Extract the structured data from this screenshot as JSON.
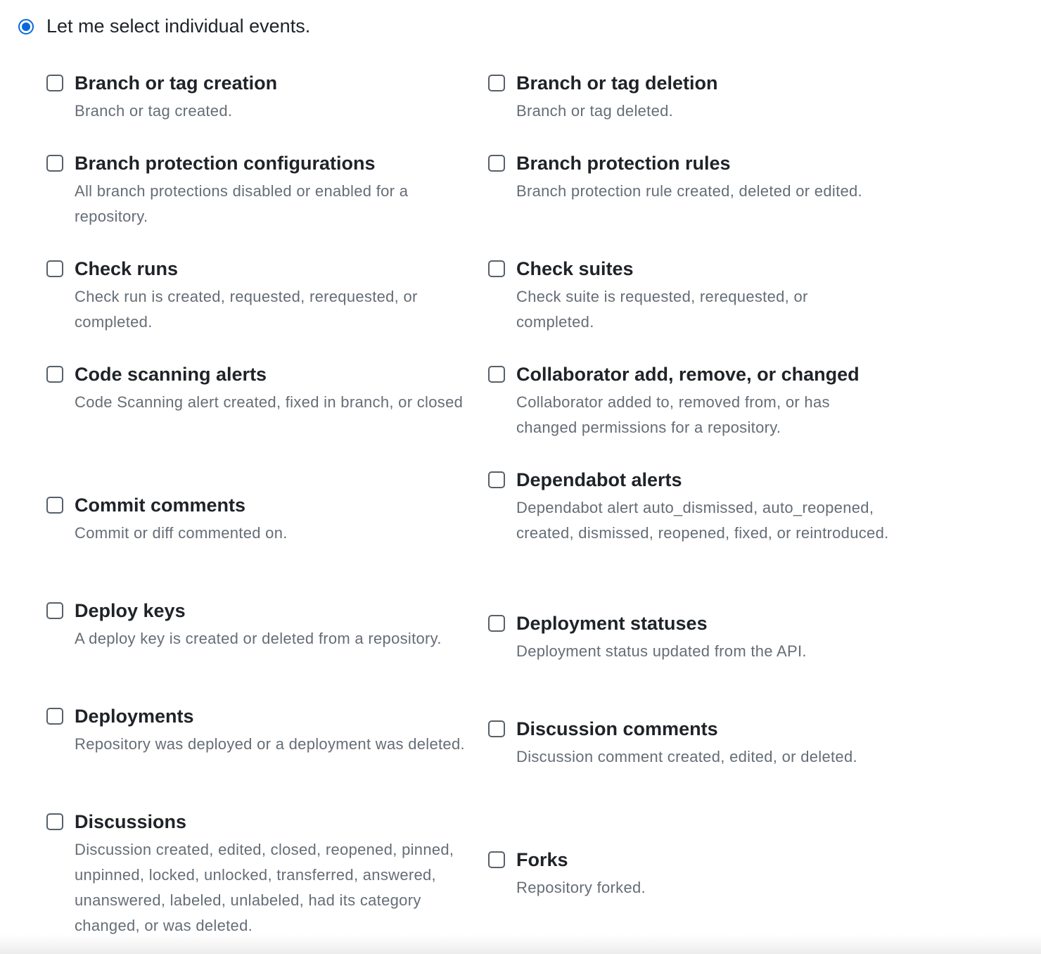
{
  "selection_mode": {
    "label": "Let me select individual events.",
    "selected": true,
    "accent_color": "#0969da"
  },
  "events_left": [
    {
      "title": "Branch or tag creation",
      "description": "Branch or tag created.",
      "checked": false
    },
    {
      "title": "Branch protection configurations",
      "description": "All branch protections disabled or enabled for a repository.",
      "checked": false
    },
    {
      "title": "Check runs",
      "description": "Check run is created, requested, rerequested, or completed.",
      "checked": false
    },
    {
      "title": "Code scanning alerts",
      "description": "Code Scanning alert created, fixed in branch, or closed",
      "checked": false
    },
    {
      "title": "Commit comments",
      "description": "Commit or diff commented on.",
      "checked": false
    },
    {
      "title": "Deploy keys",
      "description": "A deploy key is created or deleted from a repository.",
      "checked": false
    },
    {
      "title": "Deployments",
      "description": "Repository was deployed or a deployment was deleted.",
      "checked": false
    },
    {
      "title": "Discussions",
      "description": "Discussion created, edited, closed, reopened, pinned, unpinned, locked, unlocked, transferred, answered, unanswered, labeled, unlabeled, had its category changed, or was deleted.",
      "checked": false
    }
  ],
  "events_right": [
    {
      "title": "Branch or tag deletion",
      "description": "Branch or tag deleted.",
      "checked": false
    },
    {
      "title": "Branch protection rules",
      "description": "Branch protection rule created, deleted or edited.",
      "checked": false
    },
    {
      "title": "Check suites",
      "description": "Check suite is requested, rerequested, or completed.",
      "checked": false
    },
    {
      "title": "Collaborator add, remove, or changed",
      "description": "Collaborator added to, removed from, or has changed permissions for a repository.",
      "checked": false
    },
    {
      "title": "Dependabot alerts",
      "description": "Dependabot alert auto_dismissed, auto_reopened, created, dismissed, reopened, fixed, or reintroduced.",
      "checked": false
    },
    {
      "title": "Deployment statuses",
      "description": "Deployment status updated from the API.",
      "checked": false
    },
    {
      "title": "Discussion comments",
      "description": "Discussion comment created, edited, or deleted.",
      "checked": false
    },
    {
      "title": "Forks",
      "description": "Repository forked.",
      "checked": false
    }
  ]
}
